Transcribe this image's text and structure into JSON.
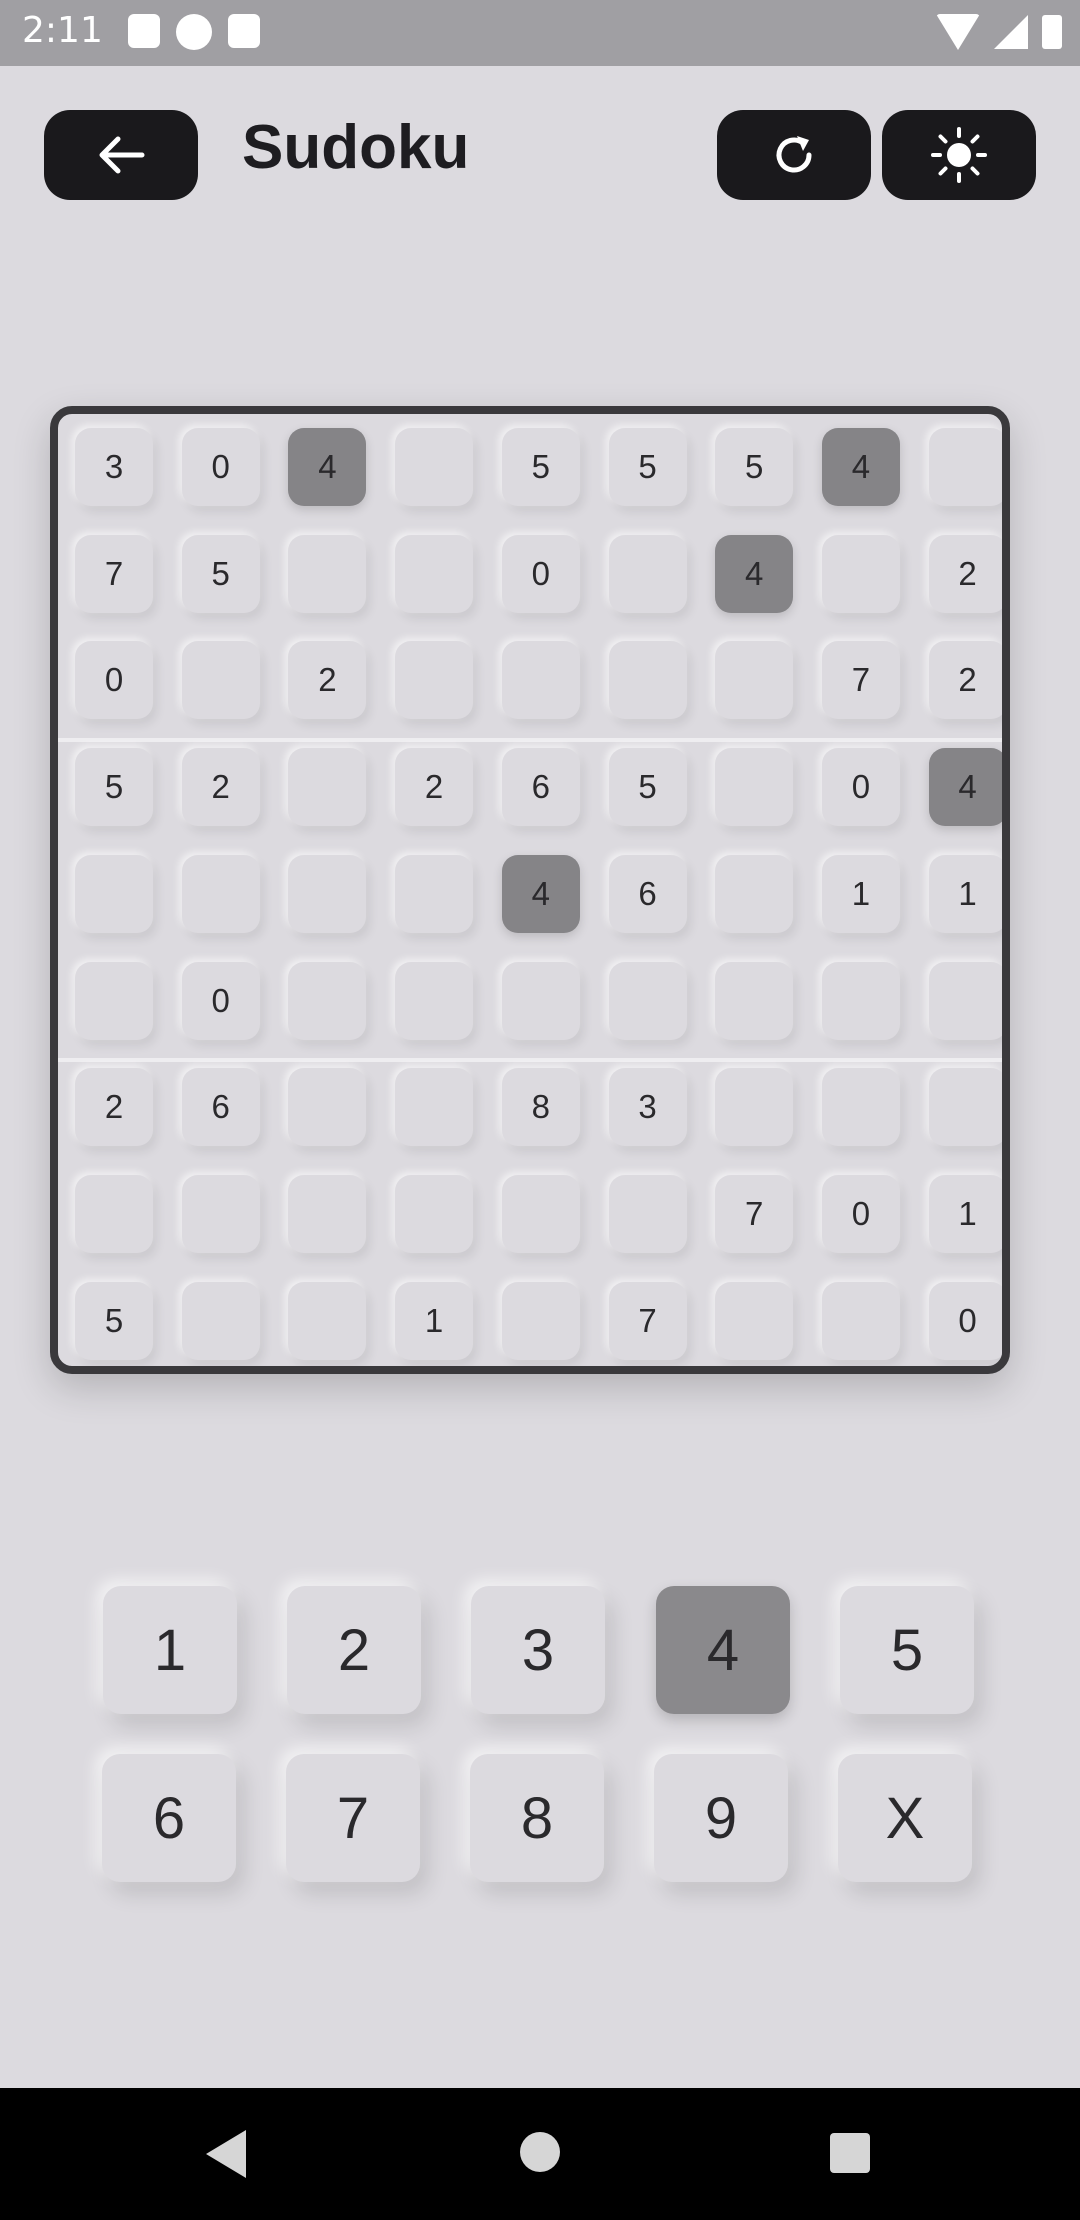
{
  "status_bar": {
    "time": "2:11"
  },
  "header": {
    "title": "Sudoku",
    "back_icon": "arrow-left-icon",
    "reset_icon": "refresh-icon",
    "theme_icon": "sun-icon"
  },
  "board": {
    "rows": [
      [
        "3",
        "0",
        "4",
        "",
        "5",
        "5",
        "5",
        "4",
        ""
      ],
      [
        "7",
        "5",
        "",
        "",
        "0",
        "",
        "4",
        "",
        "2"
      ],
      [
        "0",
        "",
        "2",
        "",
        "",
        "",
        "",
        "7",
        "2"
      ],
      [
        "5",
        "2",
        "",
        "2",
        "6",
        "5",
        "",
        "0",
        "4"
      ],
      [
        "",
        "",
        "",
        "",
        "4",
        "6",
        "",
        "1",
        "1"
      ],
      [
        "",
        "0",
        "",
        "",
        "",
        "",
        "",
        "",
        ""
      ],
      [
        "2",
        "6",
        "",
        "",
        "8",
        "3",
        "",
        "",
        ""
      ],
      [
        "",
        "",
        "",
        "",
        "",
        "",
        "7",
        "0",
        "1"
      ],
      [
        "5",
        "",
        "",
        "1",
        "",
        "7",
        "",
        "",
        "0"
      ]
    ],
    "highlighted_value": "4"
  },
  "keypad": {
    "keys": [
      "1",
      "2",
      "3",
      "4",
      "5",
      "6",
      "7",
      "8",
      "9",
      "X"
    ],
    "selected": "4"
  },
  "colors": {
    "background": "#dcdadf",
    "highlight": "#858487",
    "button_dark": "#1a191c"
  }
}
